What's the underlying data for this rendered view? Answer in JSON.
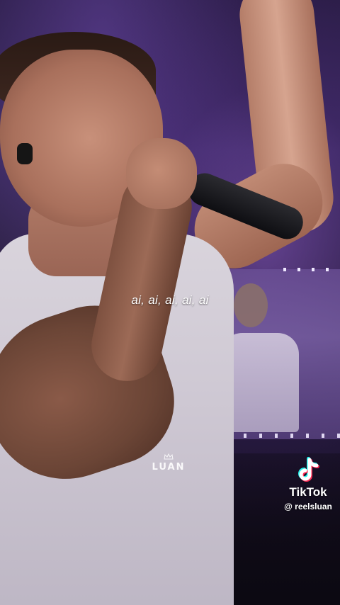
{
  "video": {
    "caption": "ai, ai, ai, ai, ai"
  },
  "watermark": {
    "logo_text": "LUAN",
    "logo_icon": "crown-icon"
  },
  "tiktok": {
    "brand": "TikTok",
    "handle": "@ reelsluan",
    "icon": "tiktok-note-icon",
    "colors": {
      "cyan": "#25F4EE",
      "red": "#FE2C55",
      "white": "#FFFFFF"
    }
  }
}
